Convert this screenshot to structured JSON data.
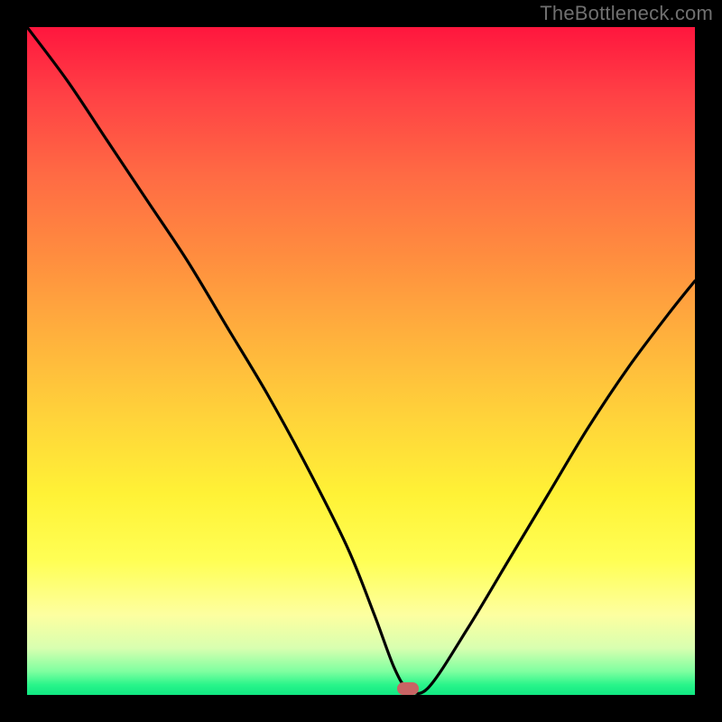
{
  "attribution": "TheBottleneck.com",
  "chart_data": {
    "type": "line",
    "title": "",
    "xlabel": "",
    "ylabel": "",
    "xlim": [
      0,
      100
    ],
    "ylim": [
      0,
      100
    ],
    "series": [
      {
        "name": "bottleneck-curve",
        "x": [
          0,
          6,
          12,
          18,
          24,
          30,
          36,
          42,
          48,
          52,
          55,
          57,
          60,
          66,
          72,
          78,
          84,
          90,
          96,
          100
        ],
        "y": [
          100,
          92,
          83,
          74,
          65,
          55,
          45,
          34,
          22,
          12,
          4,
          1,
          1,
          10,
          20,
          30,
          40,
          49,
          57,
          62
        ]
      }
    ],
    "marker": {
      "x": 57,
      "y": 1
    },
    "background_gradient_meaning": "red=high bottleneck, green=low bottleneck"
  },
  "colors": {
    "curve": "#000000",
    "marker": "#c86464",
    "frame": "#000000"
  }
}
